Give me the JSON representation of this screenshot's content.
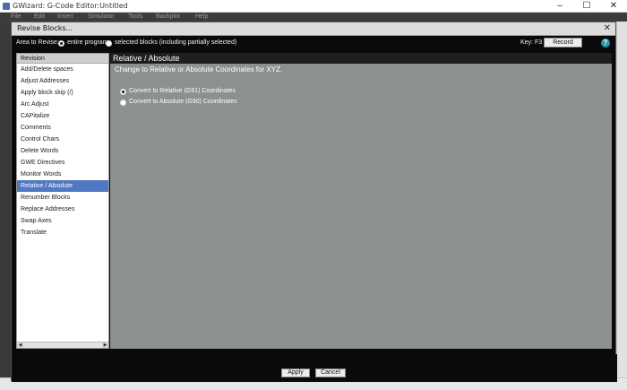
{
  "app": {
    "title": "GWizard: G-Code Editor:Untitled",
    "menu": [
      "File",
      "Edit",
      "Insert",
      "Simulator",
      "Tools",
      "Backplot",
      "Help"
    ],
    "window_controls": [
      "–",
      "☐",
      "✕"
    ]
  },
  "dialog": {
    "title": "Revise Blocks...",
    "close": "✕",
    "area_label": "Area to Revise:",
    "area_options": [
      "entire program",
      "selected blocks (including partially selected)"
    ],
    "area_selected": "entire program",
    "key_label": "Key: F3",
    "record_label": "Record",
    "help_label": "?"
  },
  "revision_list": {
    "header": "Revision",
    "items": [
      "Add/Delete spaces",
      "Adjust Addresses",
      "Apply block skip (/)",
      "Arc Adjust",
      "CAPitalize",
      "Comments",
      "Control Chars",
      "Delete Words",
      "GWE Directives",
      "Monitor Words",
      "Relative / Absolute",
      "Renumber Blocks",
      "Replace Addresses",
      "Swap Axes",
      "Translate"
    ],
    "selected": "Relative / Absolute",
    "scroll_left": "◀",
    "scroll_right": "▶"
  },
  "panel": {
    "title": "Relative / Absolute",
    "description": "Change to Relative or Absolute Coordinates for XYZ.",
    "options": [
      "Convert to Relative (G91) Coordinates",
      "Convert to Absolute (G90) Coordinates"
    ],
    "selected_option": "Convert to Relative (G91) Coordinates"
  },
  "buttons": {
    "apply": "Apply",
    "cancel": "Cancel"
  },
  "colors": {
    "selection": "#4f79c2",
    "panel_bg": "#8b9090",
    "dialog_bg": "#0a0a0a",
    "help_icon": "#1f9aa6"
  }
}
